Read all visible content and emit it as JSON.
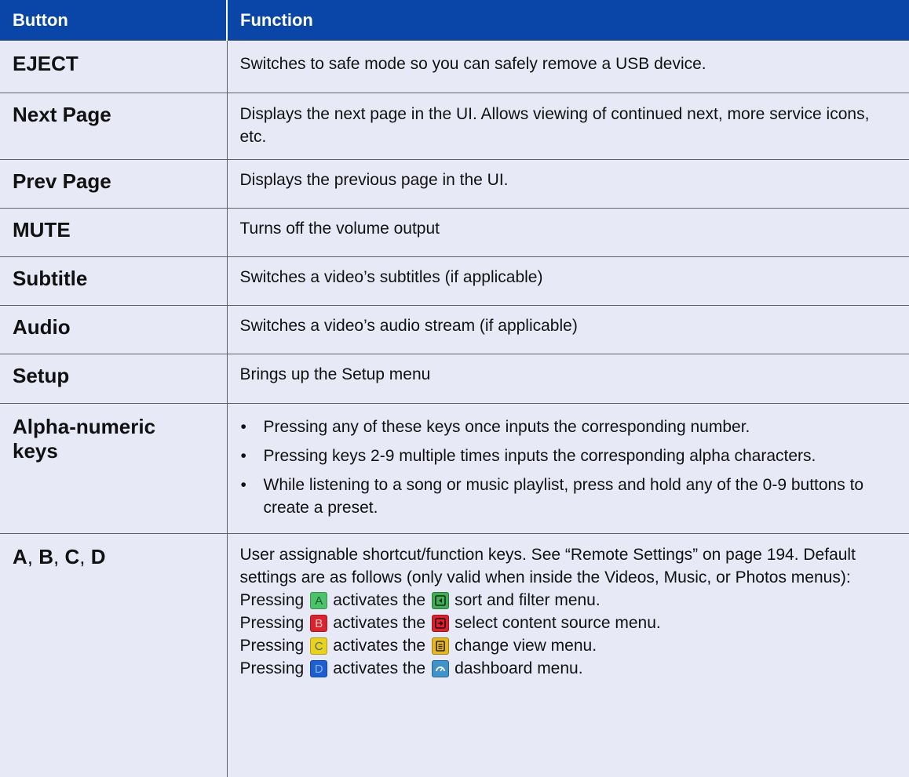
{
  "table": {
    "headers": {
      "button": "Button",
      "function": "Function"
    },
    "rows": {
      "eject": {
        "button": "EJECT",
        "function": "Switches to safe mode so you can safely remove a USB device."
      },
      "next_page": {
        "button": "Next Page",
        "function": "Displays the next page in the UI. Allows viewing of continued next, more service icons, etc."
      },
      "prev_page": {
        "button": "Prev Page",
        "function": "Displays the previous page in the UI."
      },
      "mute": {
        "button": "MUTE",
        "function": "Turns off the volume output"
      },
      "subtitle": {
        "button": "Subtitle",
        "function": "Switches a video’s subtitles (if applicable)"
      },
      "audio": {
        "button": "Audio",
        "function": "Switches a video’s audio stream (if applicable)"
      },
      "setup": {
        "button": "Setup",
        "function": "Brings up the Setup menu"
      },
      "alpha": {
        "button_line1": "Alpha-numeric",
        "button_line2": "keys",
        "bullets": [
          "Pressing any of these keys once inputs the corresponding number.",
          "Pressing keys 2-9 multiple times inputs the corresponding alpha characters.",
          "While listening to a song or music playlist, press and hold any of the 0-9 buttons to create a preset."
        ]
      },
      "abcd": {
        "keys": [
          "A",
          "B",
          "C",
          "D"
        ],
        "separator": ", ",
        "intro": "User assignable shortcut/function keys. See “Remote Settings” on page 194. Default settings are as follows (only valid when inside the Videos, Music, or Photos menus):",
        "pressing_word": "Pressing",
        "activates_text": "activates the",
        "presses": [
          {
            "key": "A",
            "key_color": "#4cc36a",
            "icon": "sort-filter-icon",
            "icon_color": "#3fae55",
            "menu": "sort and filter menu."
          },
          {
            "key": "B",
            "key_color": "#d92430",
            "icon": "content-source-icon",
            "icon_color": "#d8232f",
            "menu": "select content source menu."
          },
          {
            "key": "C",
            "key_color": "#e8d21c",
            "icon": "change-view-icon",
            "icon_color": "#e6b81a",
            "menu": "change view menu."
          },
          {
            "key": "D",
            "key_color": "#1b5fd0",
            "icon": "dashboard-icon",
            "icon_color": "#3f93c8",
            "menu": "dashboard menu."
          }
        ]
      }
    }
  }
}
